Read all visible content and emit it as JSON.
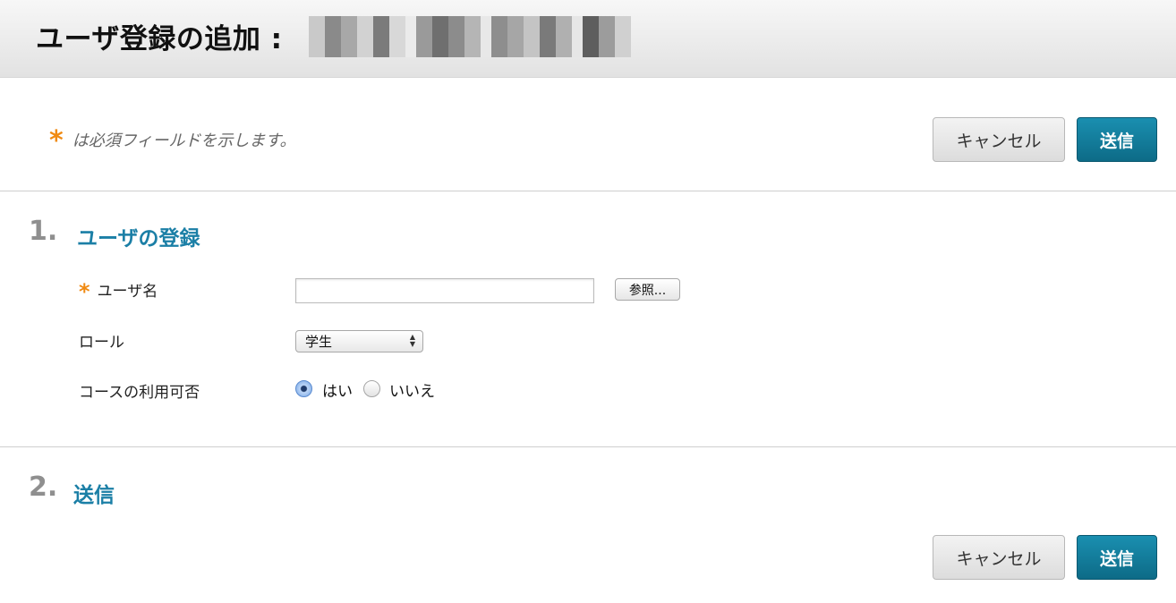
{
  "header": {
    "title": "ユーザ登録の追加 :"
  },
  "required_note": {
    "asterisk": "*",
    "text": "は必須フィールドを示します。"
  },
  "actions": {
    "cancel_label": "キャンセル",
    "submit_label": "送信"
  },
  "section1": {
    "number": "1.",
    "title": "ユーザの登録",
    "username": {
      "asterisk": "*",
      "label": "ユーザ名",
      "value": "",
      "browse_label": "参照..."
    },
    "role": {
      "label": "ロール",
      "selected": "学生"
    },
    "course_access": {
      "label": "コースの利用可否",
      "yes_label": "はい",
      "no_label": "いいえ",
      "selected": "はい"
    }
  },
  "section2": {
    "number": "2.",
    "title": "送信"
  },
  "colors": {
    "accent": "#1b7fa6",
    "required": "#f08a12",
    "submit": "#0d6b87"
  }
}
